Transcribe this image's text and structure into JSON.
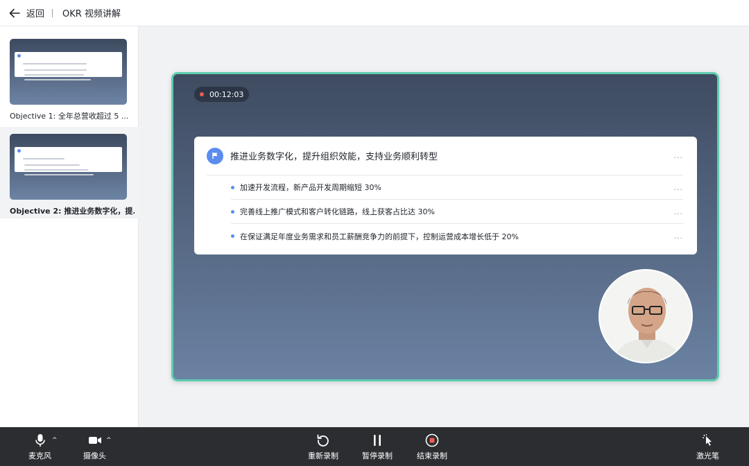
{
  "header": {
    "back_label": "返回",
    "title": "OKR 视频讲解"
  },
  "sidebar": {
    "items": [
      {
        "label": "Objective 1: 全年总营收超过 5 ..."
      },
      {
        "label": "Objective 2: 推进业务数字化，提..."
      }
    ],
    "active_index": 1
  },
  "stage": {
    "timer": "00:12:03",
    "objective": "推进业务数字化，提升组织效能，支持业务顺利转型",
    "key_results": [
      "加速开发流程，新产品开发周期缩短 30%",
      "完善线上推广模式和客户转化链路，线上获客占比达 30%",
      "在保证满足年度业务需求和员工薪酬竞争力的前提下，控制运营成本增长低于 20%"
    ],
    "more": "..."
  },
  "toolbar": {
    "mic_label": "麦克风",
    "camera_label": "摄像头",
    "rerecord_label": "重新录制",
    "pause_label": "暂停录制",
    "stop_label": "结束录制",
    "laser_label": "激光笔",
    "caret": "^"
  },
  "colors": {
    "accent": "#5b8def",
    "stage_border": "#5ecdb0",
    "rec_dot": "#f05a4f",
    "toolbar_bg": "#2b2d30"
  }
}
